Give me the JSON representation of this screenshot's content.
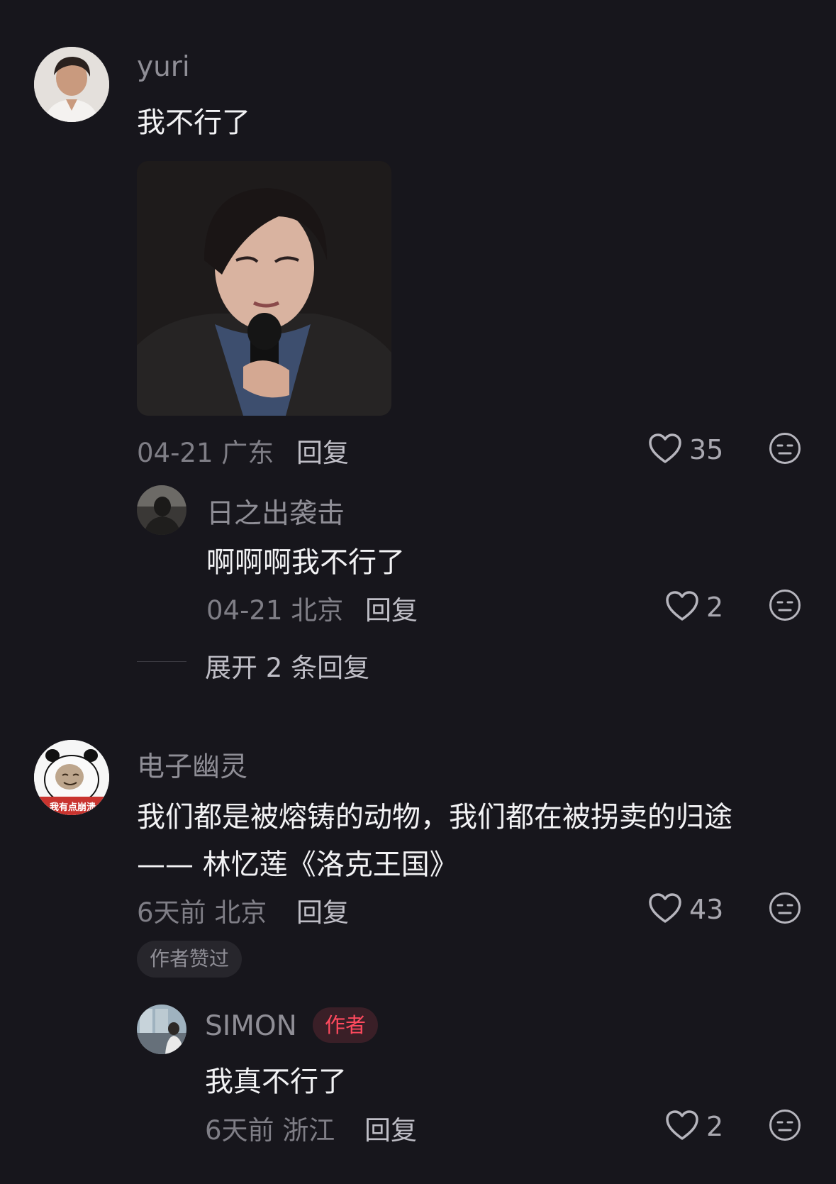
{
  "colors": {
    "background": "#17161c",
    "username": "#8f8e96",
    "content": "#f2f2f4",
    "meta": "#7f7e86",
    "author_badge_text": "#ff4a5e",
    "author_badge_bg": "#3a1f27",
    "liked_chip_bg": "#27262c"
  },
  "comments": [
    {
      "username": "yuri",
      "content": "我不行了",
      "has_image": true,
      "time": "04-21",
      "location": "广东",
      "reply_label": "回复",
      "likes": "35",
      "replies": [
        {
          "username": "日之出袭击",
          "content": "啊啊啊我不行了",
          "time": "04-21",
          "location": "北京",
          "reply_label": "回复",
          "likes": "2"
        }
      ],
      "expand_label": "展开 2 条回复"
    },
    {
      "username": "电子幽灵",
      "avatar_text": "我有点崩溃",
      "content_line1": "我们都是被熔铸的动物，我们都在被拐卖的归途",
      "content_line2": "—— 林忆莲《洛克王国》",
      "time": "6天前",
      "location": "北京",
      "reply_label": "回复",
      "likes": "43",
      "liked_by_author": "作者赞过",
      "replies": [
        {
          "username": "SIMON",
          "badge": "作者",
          "content": "我真不行了",
          "time": "6天前",
          "location": "浙江",
          "reply_label": "回复",
          "likes": "2"
        }
      ]
    }
  ]
}
